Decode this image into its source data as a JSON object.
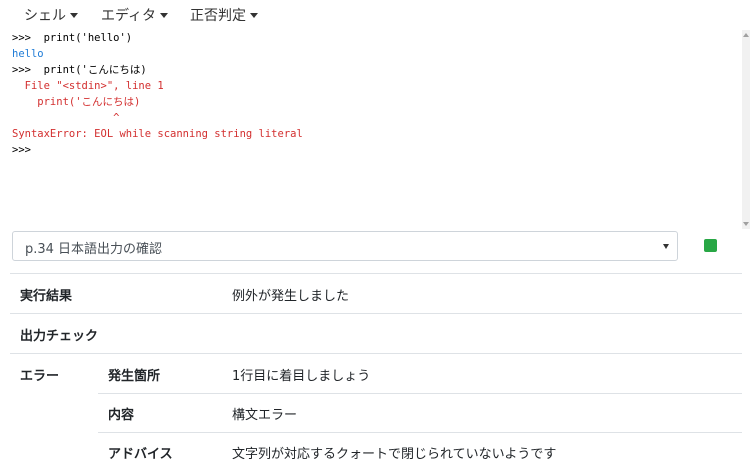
{
  "menu": {
    "items": [
      {
        "label": "シェル"
      },
      {
        "label": "エディタ"
      },
      {
        "label": "正否判定"
      }
    ]
  },
  "console": {
    "lines": [
      {
        "type": "prompt",
        "text": ">>>  print('hello')"
      },
      {
        "type": "output",
        "text": "hello"
      },
      {
        "type": "prompt",
        "text": ">>>  print('こんにちは)"
      },
      {
        "type": "error",
        "text": "  File \"<stdin>\", line 1"
      },
      {
        "type": "error",
        "text": "    print('こんにちは)"
      },
      {
        "type": "error",
        "text": "                ^"
      },
      {
        "type": "error",
        "text": "SyntaxError: EOL while scanning string literal"
      },
      {
        "type": "prompt",
        "text": ">>>"
      }
    ]
  },
  "exercise_select": {
    "selected": "p.34 日本語出力の確認"
  },
  "status": {
    "color": "#28a745"
  },
  "results": {
    "exec_result": {
      "label": "実行結果",
      "value": "例外が発生しました"
    },
    "output_check": {
      "label": "出力チェック"
    },
    "error": {
      "label": "エラー",
      "location": {
        "label": "発生箇所",
        "value": "1行目に着目しましょう"
      },
      "content": {
        "label": "内容",
        "value": "構文エラー"
      },
      "advice": {
        "label": "アドバイス",
        "value": "文字列が対応するクォートで閉じられていないようです"
      }
    }
  }
}
